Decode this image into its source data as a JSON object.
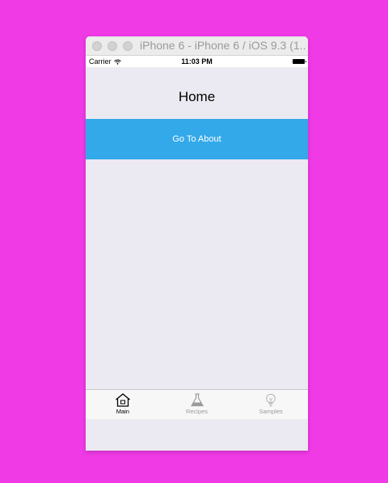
{
  "window": {
    "title": "iPhone 6 - iPhone 6 / iOS 9.3 (1..."
  },
  "status_bar": {
    "carrier": "Carrier",
    "time": "11:03 PM",
    "icons": [
      "wifi-icon",
      "battery-icon"
    ]
  },
  "page": {
    "title": "Home",
    "button_label": "Go To About"
  },
  "tab_bar": {
    "active": "Main",
    "tabs": [
      {
        "label": "Main",
        "icon": "house-icon"
      },
      {
        "label": "Recipes",
        "icon": "flask-icon"
      },
      {
        "label": "Samples",
        "icon": "lightbulb-icon"
      }
    ]
  },
  "colors": {
    "background": "#f03ae6",
    "button": "#33a9e9",
    "screen": "#ebe9f1"
  }
}
